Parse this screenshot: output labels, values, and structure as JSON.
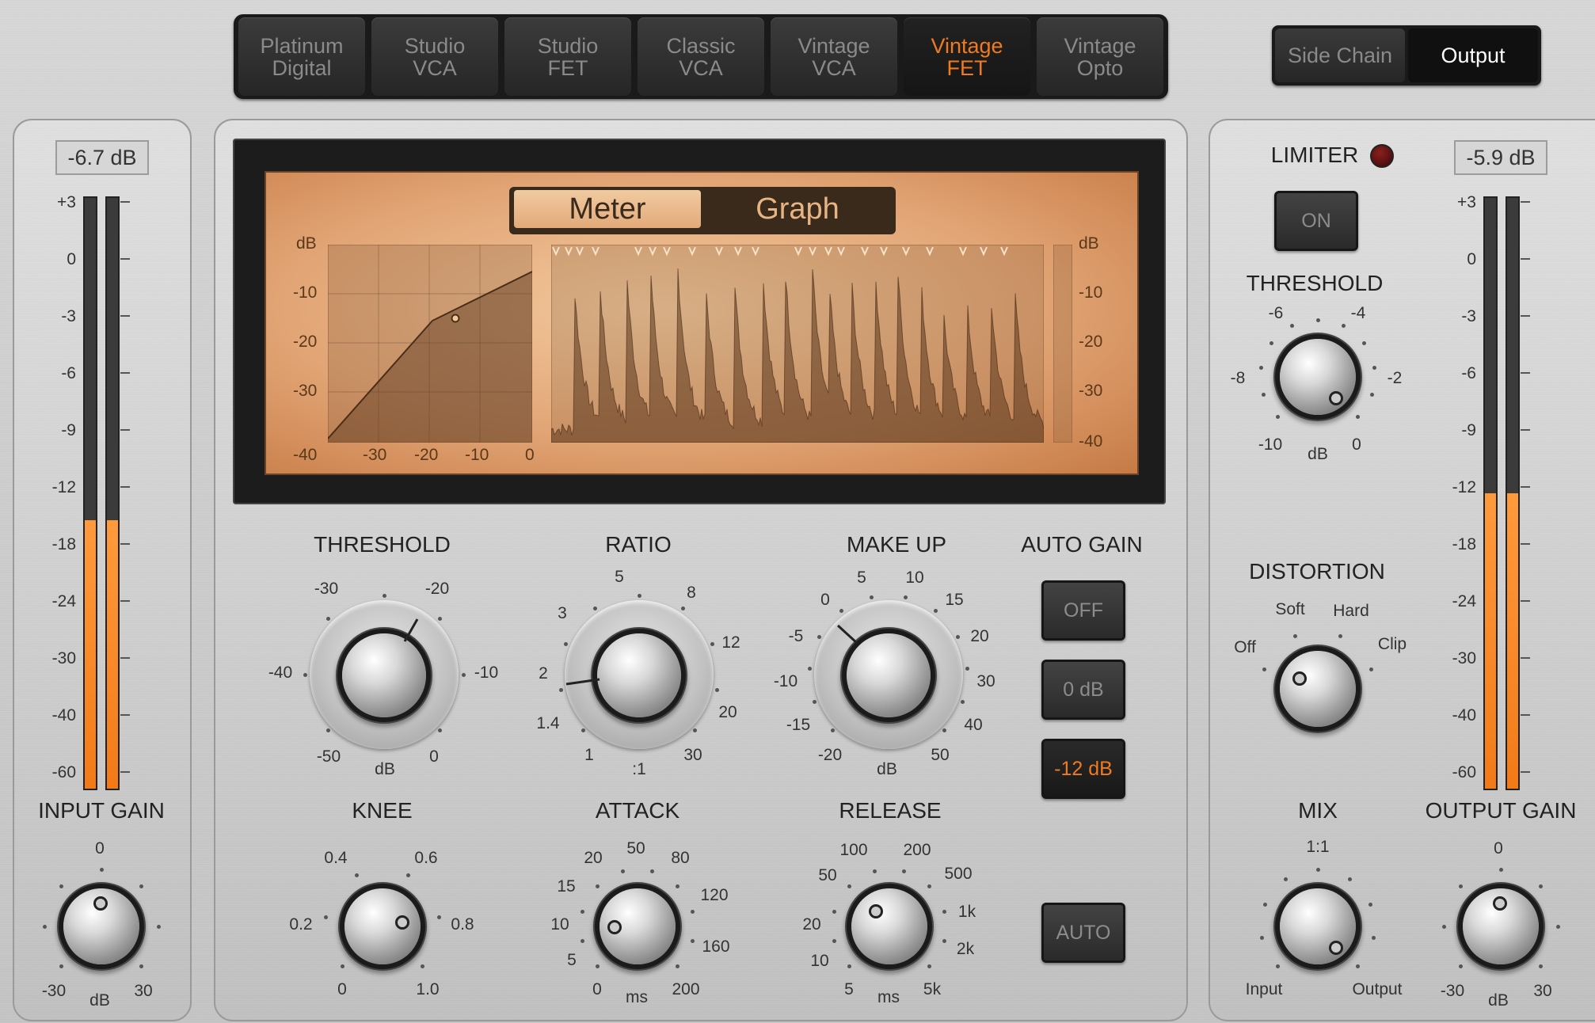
{
  "models": [
    {
      "label": "Platinum\nDigital",
      "active": false
    },
    {
      "label": "Studio\nVCA",
      "active": false
    },
    {
      "label": "Studio\nFET",
      "active": false
    },
    {
      "label": "Classic\nVCA",
      "active": false
    },
    {
      "label": "Vintage\nVCA",
      "active": false
    },
    {
      "label": "Vintage\nFET",
      "active": true
    },
    {
      "label": "Vintage\nOpto",
      "active": false
    }
  ],
  "view_toggle": {
    "side_chain": "Side Chain",
    "output": "Output",
    "selected": "Output"
  },
  "input": {
    "readout": "-6.7 dB",
    "scale": [
      "+3",
      "0",
      "-3",
      "-6",
      "-9",
      "-12",
      "-18",
      "-24",
      "-30",
      "-40",
      "-60"
    ],
    "level_fraction": 0.455,
    "gain_label": "INPUT GAIN",
    "gain_top": "0",
    "gain_left": "-30",
    "gain_right": "30",
    "gain_unit": "dB"
  },
  "output": {
    "readout": "-5.9 dB",
    "scale": [
      "+3",
      "0",
      "-3",
      "-6",
      "-9",
      "-12",
      "-18",
      "-24",
      "-30",
      "-40",
      "-60"
    ],
    "level_fraction": 0.5,
    "gain_label": "OUTPUT GAIN",
    "gain_top": "0",
    "gain_left": "-30",
    "gain_right": "30",
    "gain_unit": "dB"
  },
  "display": {
    "meter": "Meter",
    "graph": "Graph",
    "selected": "Graph",
    "db": "dB",
    "y_ticks": [
      "-10",
      "-20",
      "-30",
      "-40"
    ],
    "x_ticks": [
      "-30",
      "-20",
      "-10",
      "0"
    ],
    "right_db": "dB",
    "right_ticks": [
      "-10",
      "-20",
      "-30",
      "-40"
    ]
  },
  "threshold": {
    "label": "THRESHOLD",
    "ticks": [
      "-30",
      "-20",
      "-10",
      "0",
      "-50",
      "-40"
    ],
    "unit": "dB"
  },
  "ratio": {
    "label": "RATIO",
    "ticks": [
      "5",
      "8",
      "12",
      "20",
      "30",
      "1",
      "1.4",
      "2",
      "3"
    ],
    "unit": ":1"
  },
  "makeup": {
    "label": "MAKE UP",
    "ticks": [
      "5",
      "10",
      "15",
      "20",
      "30",
      "40",
      "50",
      "-20",
      "-15",
      "-10",
      "-5",
      "0"
    ],
    "unit": "dB"
  },
  "auto_gain": {
    "label": "AUTO GAIN",
    "off": "OFF",
    "zero": "0 dB",
    "minus12": "-12 dB",
    "selected": "-12 dB"
  },
  "knee": {
    "label": "KNEE",
    "ticks": [
      "0.4",
      "0.6",
      "0.8",
      "1.0",
      "0",
      "0.2"
    ]
  },
  "attack": {
    "label": "ATTACK",
    "ticks": [
      "50",
      "80",
      "120",
      "160",
      "200",
      "0",
      "5",
      "10",
      "15",
      "20"
    ],
    "unit": "ms"
  },
  "release": {
    "label": "RELEASE",
    "ticks": [
      "200",
      "500",
      "1k",
      "2k",
      "5k",
      "5",
      "10",
      "20",
      "50",
      "100"
    ],
    "unit": "ms",
    "auto": "AUTO"
  },
  "limiter": {
    "label": "LIMITER",
    "on": "ON"
  },
  "limiter_threshold": {
    "label": "THRESHOLD",
    "ticks": [
      "-6",
      "-4",
      "-2",
      "0",
      "-10",
      "-8"
    ],
    "unit": "dB"
  },
  "distortion": {
    "label": "DISTORTION",
    "off": "Off",
    "soft": "Soft",
    "hard": "Hard",
    "clip": "Clip"
  },
  "mix": {
    "label": "MIX",
    "top": "1:1",
    "left": "Input",
    "right": "Output"
  },
  "colors": {
    "accent": "#f07a1f",
    "meter": "#f27a17",
    "display": "#e2a575"
  }
}
